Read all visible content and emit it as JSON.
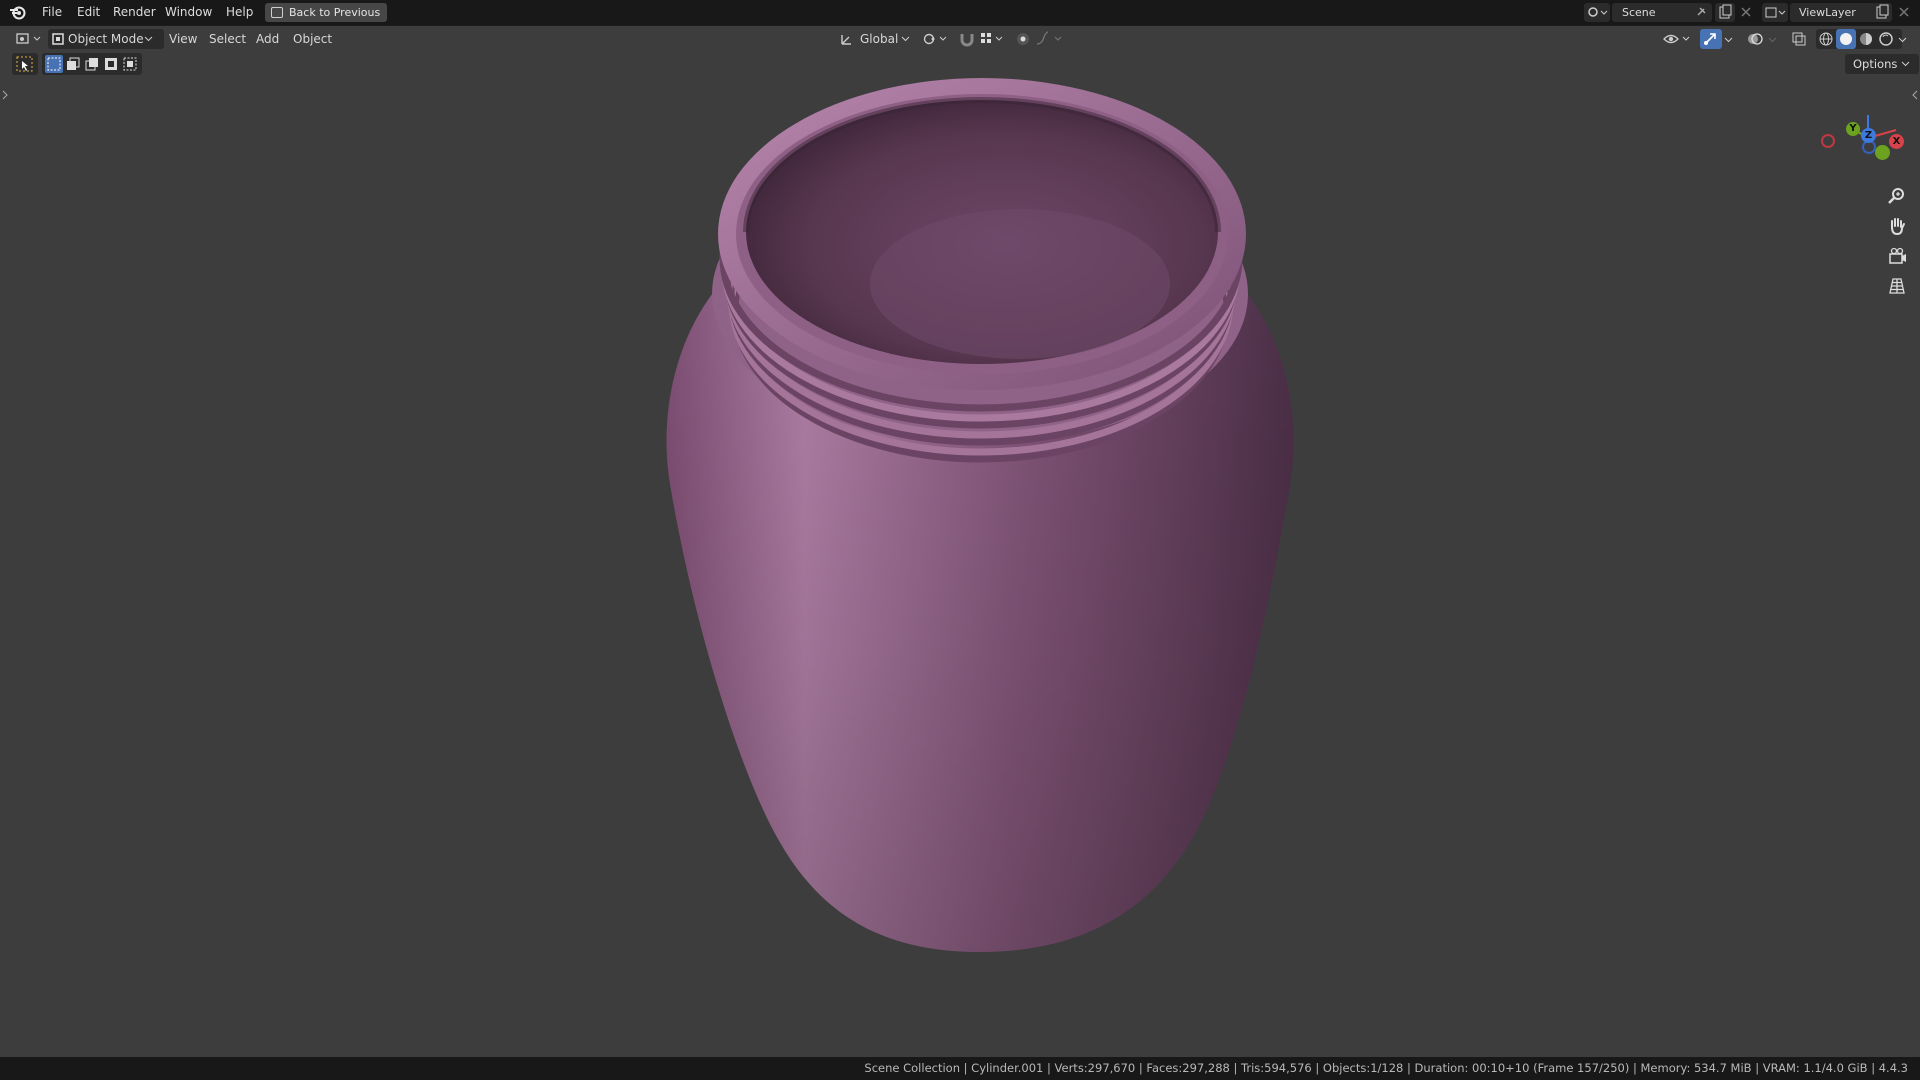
{
  "menu": [
    "File",
    "Edit",
    "Render",
    "Window",
    "Help"
  ],
  "back_button": "Back to Previous",
  "scene": {
    "name": "Scene",
    "view_layer": "ViewLayer"
  },
  "header": {
    "mode": "Object Mode",
    "menus": [
      "View",
      "Select",
      "Add",
      "Object"
    ],
    "transform_orientation": "Global",
    "options": "Options"
  },
  "gizmo": {
    "x": "X",
    "y": "Y",
    "z": "Z"
  },
  "nav_icons": [
    "zoom-icon",
    "pan-hand-icon",
    "camera-icon",
    "perspective-grid-icon"
  ],
  "status": {
    "text": "Scene Collection | Cylinder.001 | Verts:297,670 | Faces:297,288 | Tris:594,576 | Objects:1/128 | Duration: 00:10+10 (Frame 157/250) | Memory: 534.7 MiB | VRAM: 1.1/4.0 GiB | 4.4.3"
  },
  "colors": {
    "accent": "#4772b3",
    "object": "#9a6890",
    "axis_x": "#d8424b",
    "axis_y": "#6ca21f",
    "axis_z": "#3c7ae0"
  }
}
